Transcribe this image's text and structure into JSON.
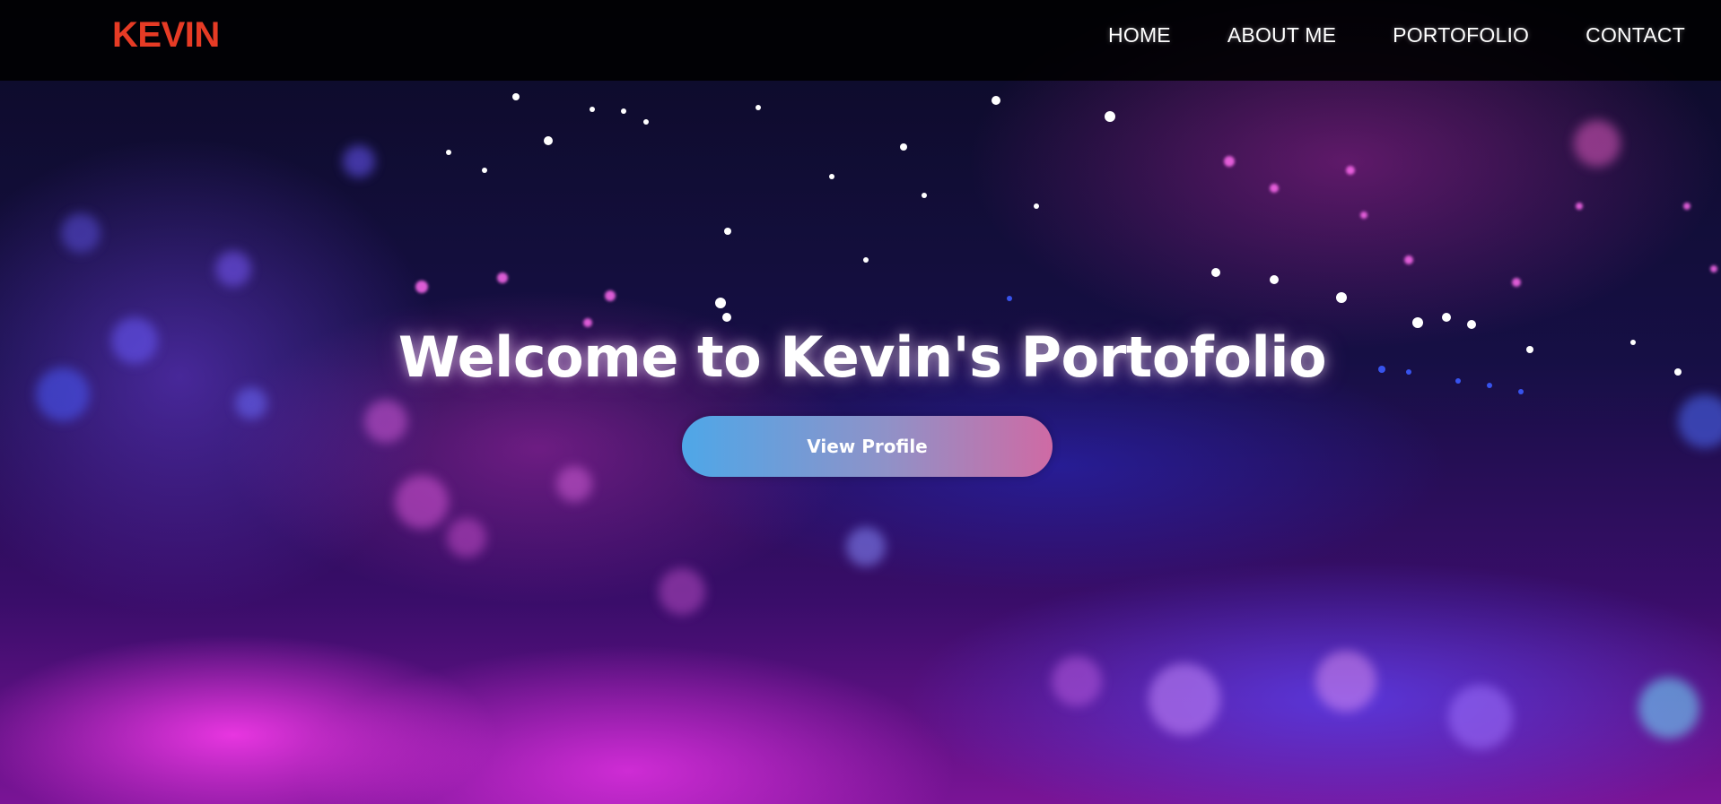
{
  "brand": {
    "name": "KEVIN",
    "color": "#e63b25"
  },
  "nav": {
    "items": [
      {
        "label": "HOME"
      },
      {
        "label": "ABOUT ME"
      },
      {
        "label": "PORTOFOLIO"
      },
      {
        "label": "CONTACT"
      }
    ]
  },
  "hero": {
    "headline": "Welcome to Kevin's Portofolio",
    "cta_label": "View Profile",
    "cta_gradient": [
      "#4ea7e8",
      "#cf6aa4"
    ],
    "background": "bokeh-particles-image"
  }
}
